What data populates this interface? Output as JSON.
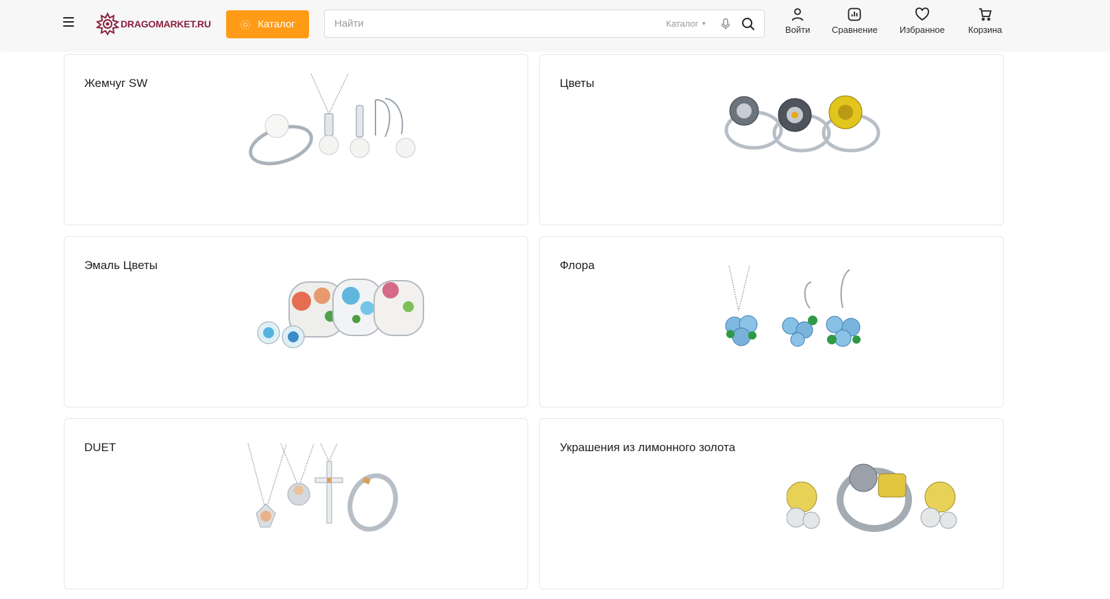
{
  "header": {
    "logo_text": "DRAGOMARKET.RU",
    "catalog_label": "Каталог",
    "search": {
      "placeholder": "Найти",
      "scope": "Каталог"
    },
    "nav": [
      {
        "label": "Войти",
        "icon": "user-icon"
      },
      {
        "label": "Сравнение",
        "icon": "compare-chart-icon"
      },
      {
        "label": "Избранное",
        "icon": "heart-icon"
      },
      {
        "label": "Корзина",
        "icon": "cart-icon"
      }
    ]
  },
  "colors": {
    "accent": "#ff9b17",
    "brand": "#8a1f3c"
  },
  "collections": [
    {
      "title": "Жемчуг SW"
    },
    {
      "title": "Цветы"
    },
    {
      "title": "Эмаль Цветы"
    },
    {
      "title": "Флора"
    },
    {
      "title": "DUET"
    },
    {
      "title": "Украшения из лимонного золота"
    }
  ]
}
